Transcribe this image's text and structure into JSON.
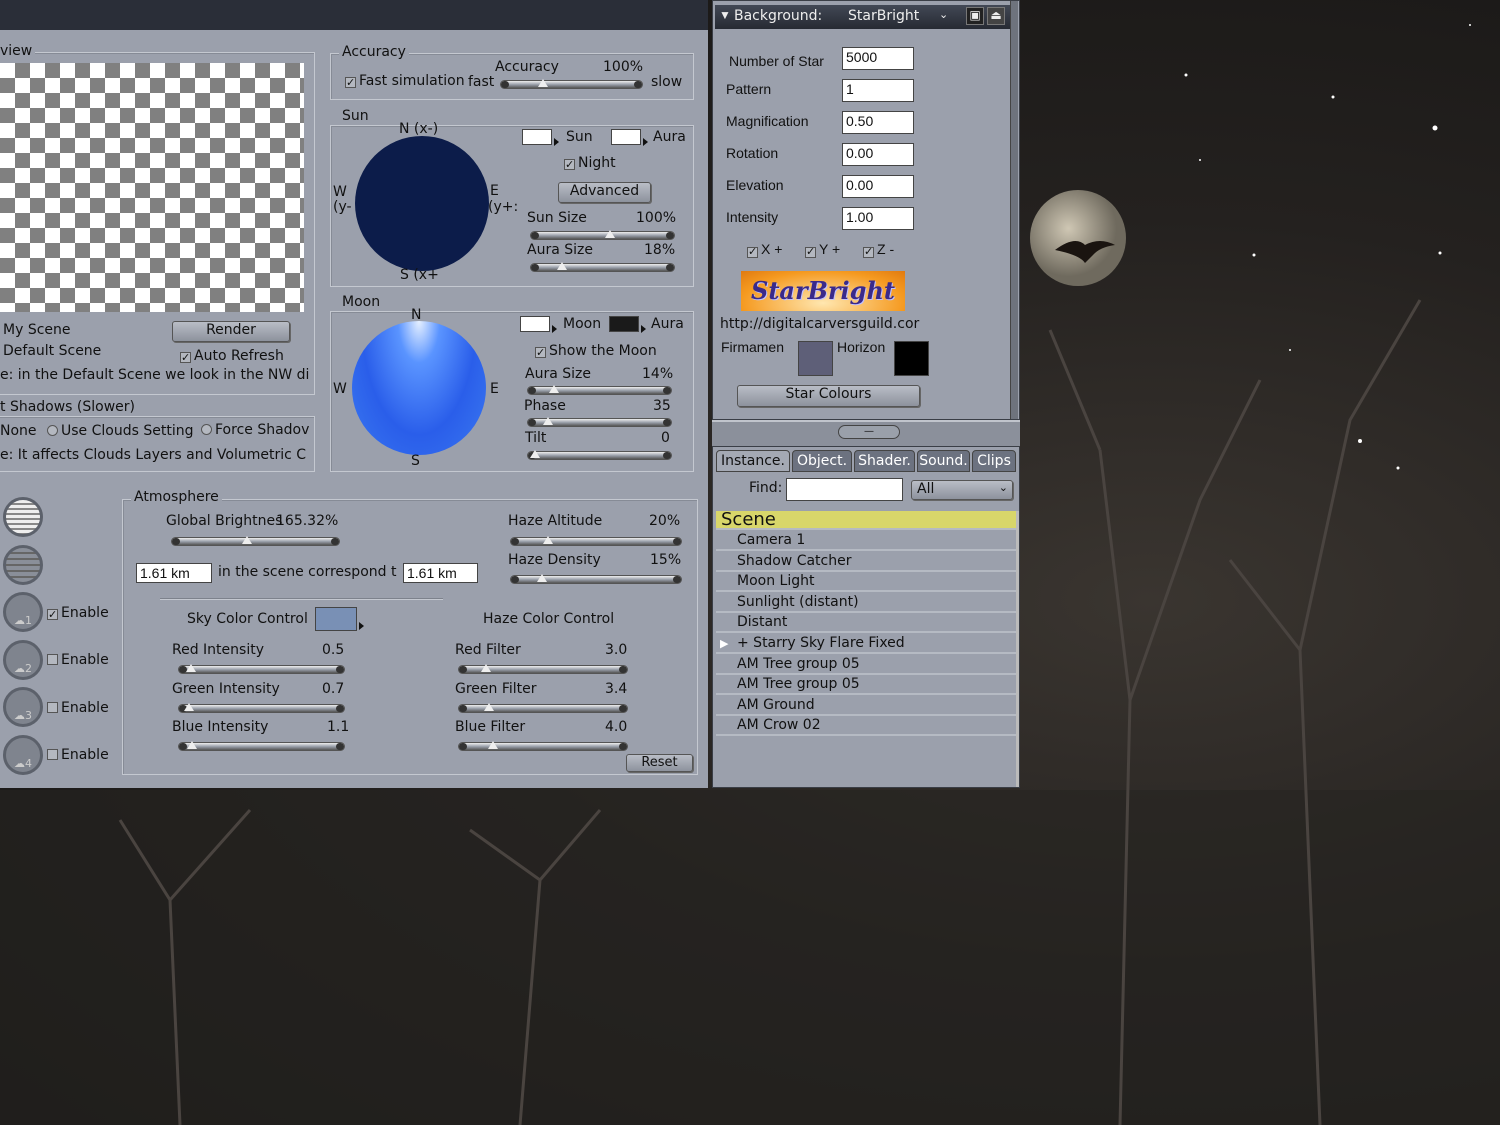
{
  "colors": {
    "panel": "#9ba0ac",
    "sun_disc": "#0c1c4a",
    "moon_disc": "#3370ee",
    "sky_color": "#7990b5",
    "firmament": "#5e5f78",
    "horizon": "#000000",
    "scene_highlight": "#d8d66a"
  },
  "preview": {
    "legend": "view",
    "scene_name": "My Scene",
    "scene_type": "Default Scene",
    "render": "Render",
    "auto_refresh": "Auto Refresh",
    "auto_refresh_checked": true,
    "note": "e: in the Default Scene we look in the NW di"
  },
  "shadows": {
    "legend": "t Shadows (Slower)",
    "none": "None",
    "use_clouds": "Use Clouds Setting",
    "force": "Force Shadov",
    "note": "e: It affects Clouds Layers and Volumetric C"
  },
  "accuracy": {
    "legend": "Accuracy",
    "fast_sim": "Fast simulation",
    "fast_sim_checked": true,
    "fast": "fast",
    "label": "Accuracy",
    "value": "100%",
    "slow": "slow",
    "pos": 0.3
  },
  "sun": {
    "legend": "Sun",
    "n": "N (x-)",
    "w1": "W",
    "w2": "(y-",
    "e1": "E",
    "e2": "(y+:",
    "s": "S (x+",
    "sun": "Sun",
    "aura": "Aura",
    "night": "Night",
    "night_checked": true,
    "advanced": "Advanced",
    "sun_size": {
      "label": "Sun Size",
      "value": "100%",
      "pos": 0.55
    },
    "aura_size": {
      "label": "Aura Size",
      "value": "18%",
      "pos": 0.22
    }
  },
  "moon": {
    "legend": "Moon",
    "n": "N",
    "w": "W",
    "e": "E",
    "s": "S",
    "moon": "Moon",
    "aura": "Aura",
    "show": "Show the Moon",
    "show_checked": true,
    "aura_size": {
      "label": "Aura Size",
      "value": "14%",
      "pos": 0.18
    },
    "phase": {
      "label": "Phase",
      "value": "35",
      "pos": 0.14
    },
    "tilt": {
      "label": "Tilt",
      "value": "0",
      "pos": 0.05
    }
  },
  "clouds": {
    "enable": "Enable",
    "layers": [
      {
        "num": "1",
        "checked": true
      },
      {
        "num": "2",
        "checked": false
      },
      {
        "num": "3",
        "checked": false
      },
      {
        "num": "4",
        "checked": false
      }
    ]
  },
  "atmosphere": {
    "legend": "Atmosphere",
    "global_brightness": {
      "label": "Global Brightness",
      "value": "165.32%",
      "pos": 0.45
    },
    "haze_altitude": {
      "label": "Haze Altitude",
      "value": "20%",
      "pos": 0.22
    },
    "haze_density": {
      "label": "Haze Density",
      "value": "15%",
      "pos": 0.18
    },
    "km_left": "1.61 km",
    "correspond": "in the scene correspond t",
    "km_right": "1.61 km",
    "sky_color_control": "Sky Color Control",
    "haze_color_control": "Haze Color Control",
    "red_intensity": {
      "label": "Red Intensity",
      "value": "0.5",
      "pos": 0.07
    },
    "green_intensity": {
      "label": "Green Intensity",
      "value": "0.7",
      "pos": 0.06
    },
    "blue_intensity": {
      "label": "Blue Intensity",
      "value": "1.1",
      "pos": 0.08
    },
    "red_filter": {
      "label": "Red Filter",
      "value": "3.0",
      "pos": 0.16
    },
    "green_filter": {
      "label": "Green Filter",
      "value": "3.4",
      "pos": 0.18
    },
    "blue_filter": {
      "label": "Blue Filter",
      "value": "4.0",
      "pos": 0.2
    },
    "reset": "Reset"
  },
  "background": {
    "header": "Background:",
    "preset": "StarBright",
    "fields": [
      {
        "label": "Number of Star",
        "value": "5000"
      },
      {
        "label": "Pattern",
        "value": "1"
      },
      {
        "label": "Magnification",
        "value": "0.50"
      },
      {
        "label": "Rotation",
        "value": "0.00"
      },
      {
        "label": "Elevation",
        "value": "0.00"
      },
      {
        "label": "Intensity",
        "value": "1.00"
      }
    ],
    "axes": [
      {
        "label": "X +",
        "checked": true
      },
      {
        "label": "Y +",
        "checked": true
      },
      {
        "label": "Z -",
        "checked": true
      }
    ],
    "logo": "StarBright",
    "url": "http://digitalcarversguild.cor",
    "firmament": "Firmamen",
    "horizon": "Horizon",
    "star_colours": "Star Colours"
  },
  "browser": {
    "tabs": [
      "Instance.",
      "Object.",
      "Shader.",
      "Sound.",
      "Clips"
    ],
    "find": "Find:",
    "find_value": "",
    "filter": "All",
    "root": "Scene",
    "items": [
      "Camera 1",
      "Shadow Catcher",
      "Moon Light",
      "Sunlight (distant)",
      "Distant",
      "+ Starry Sky Flare Fixed",
      "AM Tree group 05",
      "AM Tree group 05",
      "AM Ground",
      "AM Crow 02"
    ]
  }
}
